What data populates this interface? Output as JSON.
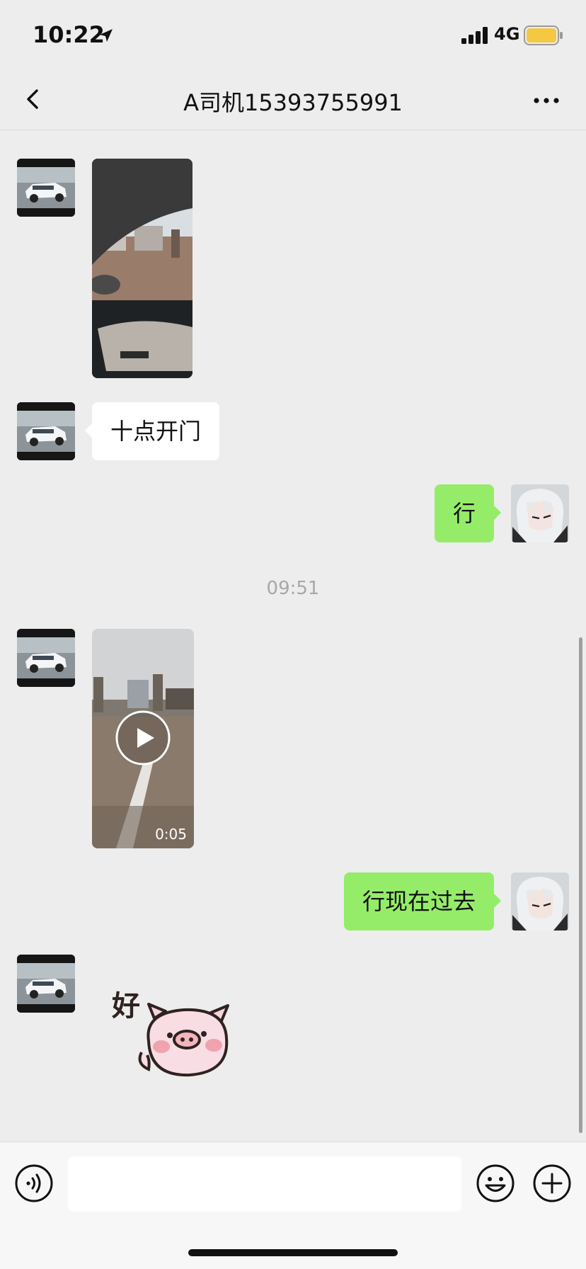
{
  "status_bar": {
    "time": "10:22",
    "network": "4G"
  },
  "nav": {
    "title": "A司机15393755991"
  },
  "messages": [
    {
      "type": "image",
      "side": "left"
    },
    {
      "type": "text",
      "side": "left",
      "text": "十点开门"
    },
    {
      "type": "text",
      "side": "right",
      "text": "行"
    },
    {
      "type": "time",
      "text": "09:51"
    },
    {
      "type": "video",
      "side": "left",
      "duration": "0:05"
    },
    {
      "type": "text",
      "side": "right",
      "text": "行现在过去"
    },
    {
      "type": "sticker",
      "side": "left",
      "text": "好"
    }
  ],
  "input": {
    "placeholder": ""
  },
  "icons": {
    "back": "chevron-left-icon",
    "more": "more-icon",
    "voice": "voice-icon",
    "emoji": "emoji-icon",
    "plus": "plus-icon"
  },
  "colors": {
    "background": "#ededed",
    "sent_bubble": "#95ec69",
    "received_bubble": "#ffffff",
    "battery": "#f5c842"
  }
}
